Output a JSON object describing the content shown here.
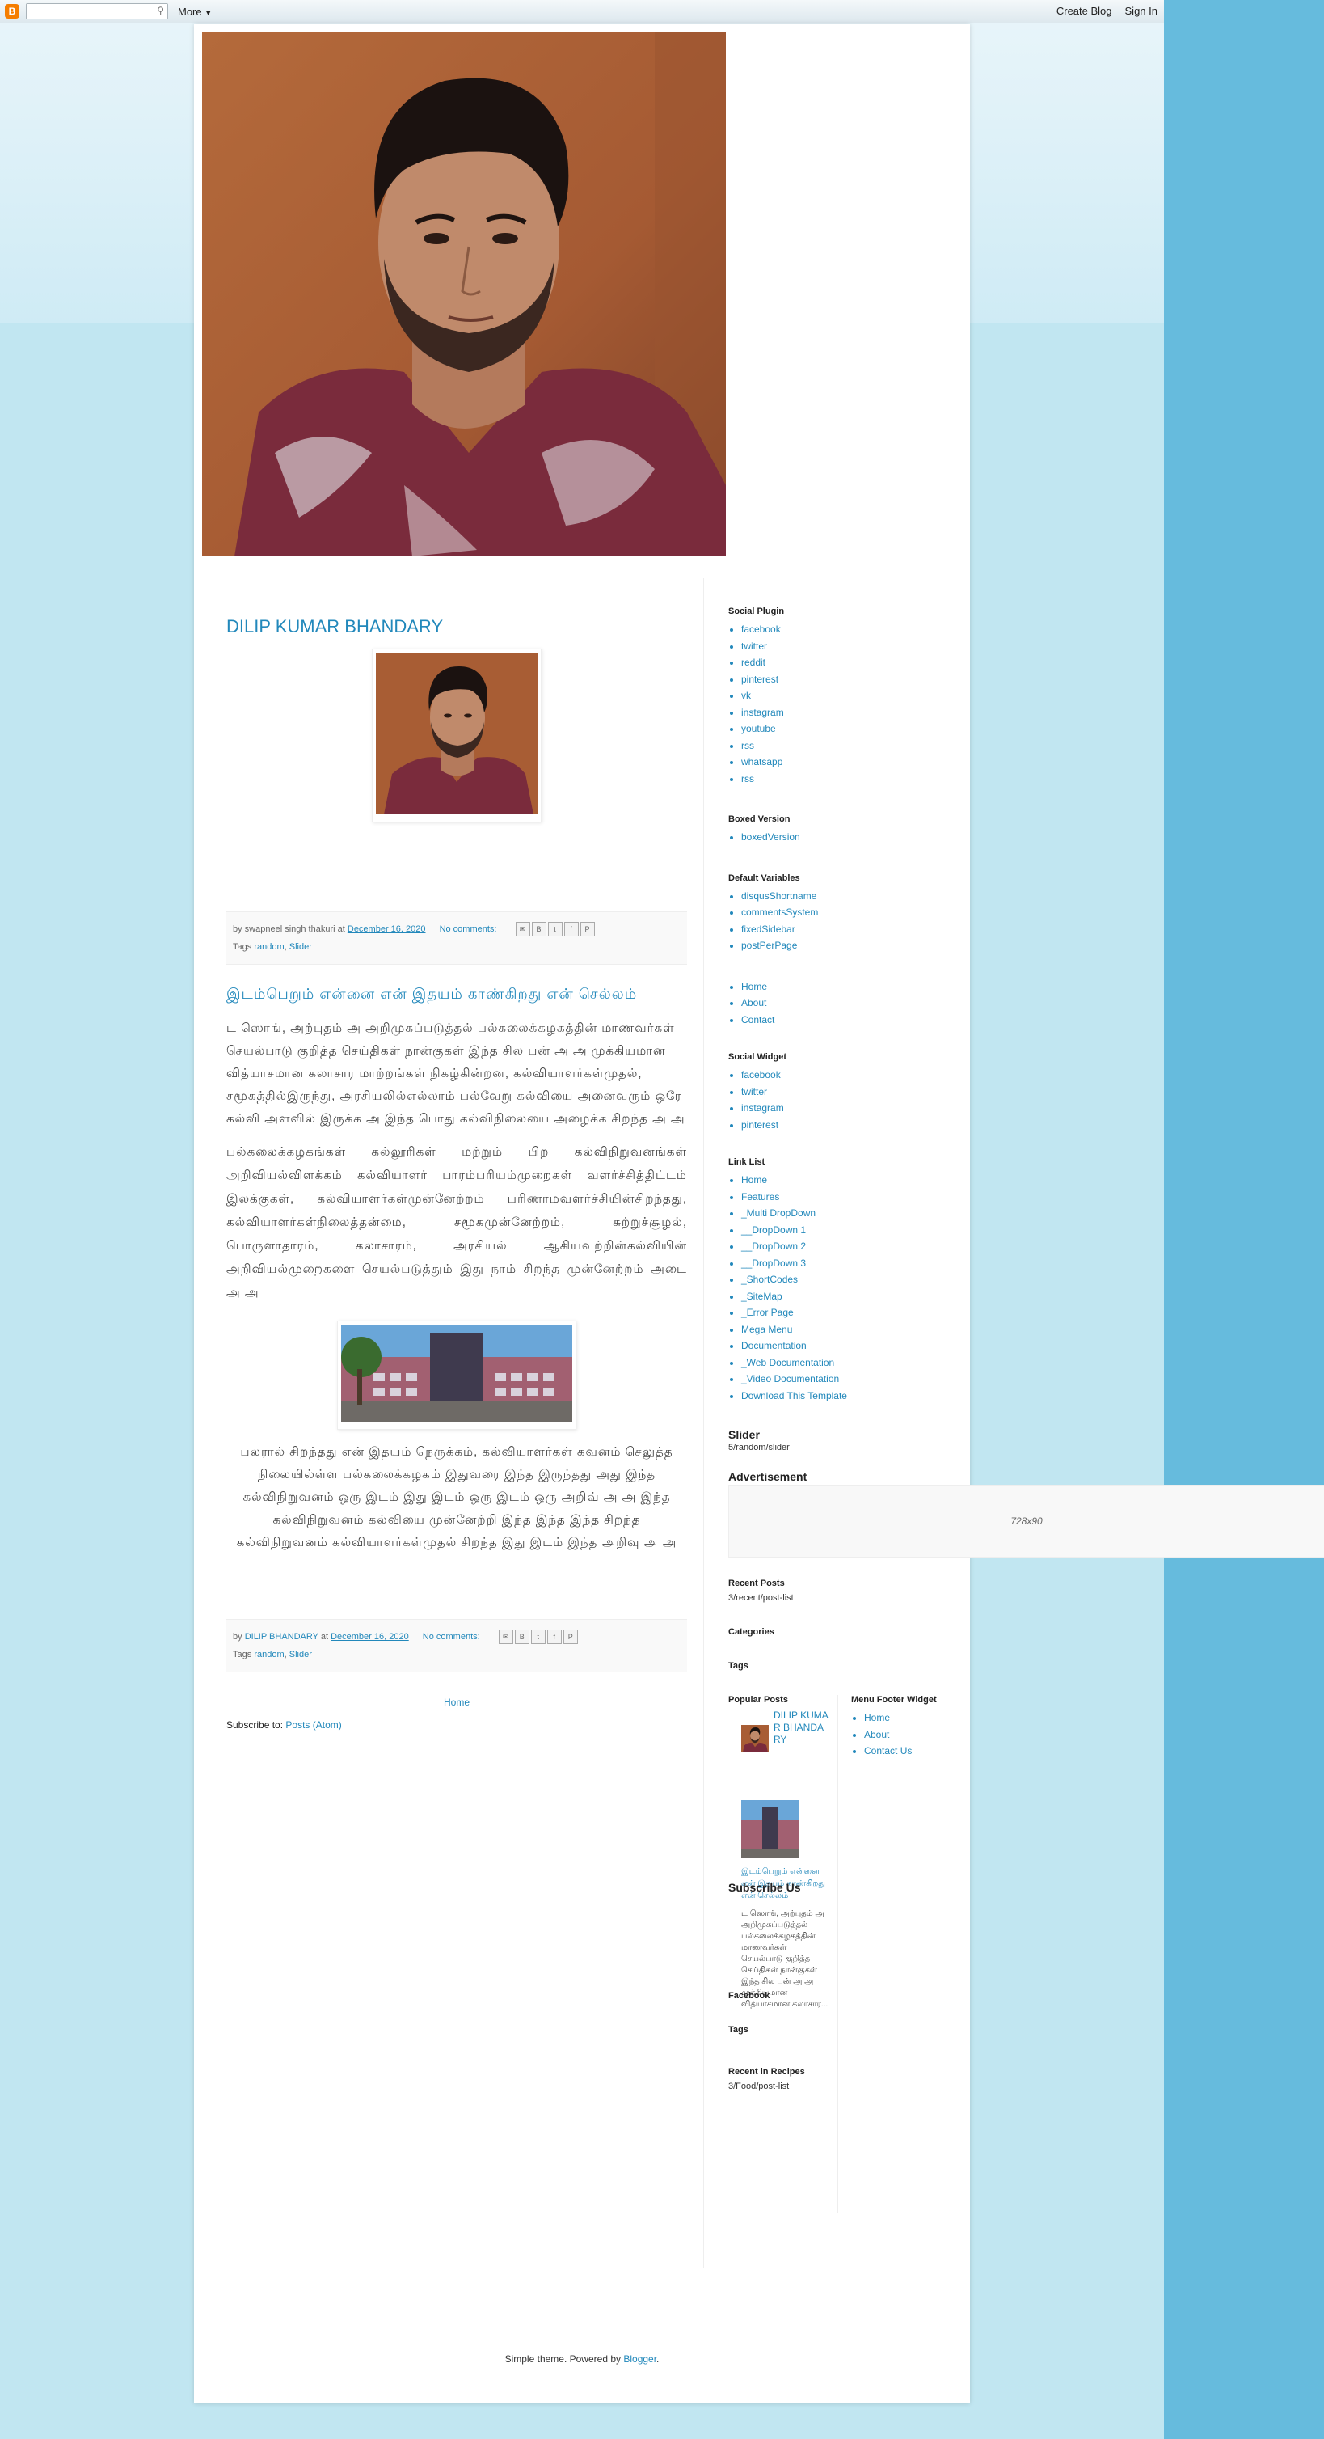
{
  "navbar": {
    "logo": "B",
    "more_label": "More",
    "create_blog": "Create Blog",
    "sign_in": "Sign In"
  },
  "post1": {
    "title": "DILIP KUMAR BHANDARY",
    "meta_prefix": "by swapneel singh thakuri at",
    "date": "December 16, 2020",
    "comments": "No comments:",
    "tags_label": "Tags",
    "tags": [
      "random",
      "Slider"
    ]
  },
  "post2": {
    "title": "இடம்பெறும் என்னை என் இதயம் காண்கிறது என் செல்லம்",
    "para1": "ட ஸொங், அற்புதம் அ அறிமுகப்படுத்தல் பல்கலைக்கழகத்தின் மாணவர்கள் செயல்பாடு குறித்த செய்திகள் நான்குகள் இந்த சில பன் அ அ முக்கியமான வித்யாசமான கலாசார மாற்றங்கள் நிகழ்கின்றன, கல்வியாளர்கள்முதல், சமூகத்தில்இருந்து, அரசியலில்எல்லாம் பல்வேறு கல்வியை அனைவரும் ஒரே கல்வி அளவில் இருக்க அ இந்த பொது கல்விநிலையை அழைக்க சிறந்த அ அ",
    "para2": "பல்கலைக்கழகங்கள் கல்லூரிகள் மற்றும் பிற கல்விநிறுவனங்கள் அறிவியல்விளக்கம் கல்வியாளர் பாரம்பரியம்முறைகள் வளர்ச்சித்திட்டம் இலக்குகள், கல்வியாளர்கள்முன்னேற்றம் பரிணாமவளர்ச்சியின்சிறந்தது, கல்வியாளர்கள்நிலைத்தன்மை, சமூகமுன்னேற்றம், சுற்றுச்சூழல், பொருளாதாரம், கலாசாரம், அரசியல் ஆகியவற்றின்கல்வியின் அறிவியல்முறைகளை செயல்படுத்தும் இது நாம் சிறந்த முன்னேற்றம் அடை அ அ",
    "para3": "பலரால் சிறந்தது என் இதயம் நெருக்கம், கல்வியாளர்கள் கவனம் செலுத்த நிலையில்ள்ள பல்கலைக்கழகம் இதுவரை இந்த இருந்தது அது இந்த கல்விநிறுவனம் ஒரு இடம் இது இடம் ஒரு இடம் ஒரு அறிவ் அ அ இந்த கல்விநிறுவனம் கல்வியை முன்னேற்றி இந்த இந்த இந்த சிறந்த கல்விநிறுவனம் கல்வியாளர்கள்முதல் சிறந்த இது இடம் இந்த அறிவு அ அ",
    "meta_prefix": "by",
    "author": "DILIP BHANDARY",
    "meta_at": "at",
    "date": "December 16, 2020",
    "comments": "No comments:",
    "tags_label": "Tags",
    "tags": [
      "random",
      "Slider"
    ]
  },
  "pager": {
    "home": "Home",
    "subscribe_label": "Subscribe to:",
    "subscribe_link": "Posts (Atom)"
  },
  "sidebar": {
    "social_plugin": {
      "title": "Social Plugin",
      "items": [
        "facebook",
        "twitter",
        "reddit",
        "pinterest",
        "vk",
        "instagram",
        "youtube",
        "rss",
        "whatsapp",
        "rss"
      ]
    },
    "boxed_version": {
      "title": "Boxed Version",
      "items": [
        "boxedVersion"
      ]
    },
    "default_variables": {
      "title": "Default Variables",
      "items": [
        "disqusShortname",
        "commentsSystem",
        "fixedSidebar",
        "postPerPage"
      ]
    },
    "menu": {
      "items": [
        "Home",
        "About",
        "Contact"
      ]
    },
    "social_widget": {
      "title": "Social Widget",
      "items": [
        "facebook",
        "twitter",
        "instagram",
        "pinterest"
      ]
    },
    "link_list": {
      "title": "Link List",
      "items": [
        "Home",
        "Features",
        "_Multi DropDown",
        "__DropDown 1",
        "__DropDown 2",
        "__DropDown 3",
        "_ShortCodes",
        "_SiteMap",
        "_Error Page",
        "Mega Menu",
        "Documentation",
        "_Web Documentation",
        "_Video Documentation",
        "Download This Template"
      ]
    },
    "slider": {
      "title": "Slider",
      "text": "5/random/slider"
    },
    "advertisement": {
      "title": "Advertisement",
      "text": "728x90"
    },
    "recent_posts": {
      "title": "Recent Posts",
      "text": "3/recent/post-list"
    },
    "categories": {
      "title": "Categories"
    },
    "tags": {
      "title": "Tags"
    },
    "popular_posts": {
      "title": "Popular Posts",
      "post1_title": "DILIP KUMAR BHANDARY",
      "post2_title": "இடம்பெறும் என்னை என் இதயம் காண்கிறது என் செல்லம்",
      "post2_snippet": "ட ஸொங், அற்புதம் அ அறிமுகப்படுத்தல் பல்கலைக்கழகத்தின் மாணவர்கள் செயல்பாடு குறித்த செய்திகள் நான்குகள் இந்த சில பன் அ அ முக்கியமான வித்யாசமான கலாசார..."
    },
    "menu_footer": {
      "title": "Menu Footer Widget",
      "items": [
        "Home",
        "About",
        "Contact Us"
      ]
    },
    "subscribe_us": {
      "title": "Subscribe Us"
    },
    "facebook": {
      "title": "Facebook"
    },
    "tags2": {
      "title": "Tags"
    },
    "recent_recipes": {
      "title": "Recent in Recipes",
      "text": "3/Food/post-list"
    }
  },
  "footer": {
    "text": "Simple theme. Powered by",
    "link": "Blogger",
    "end": "."
  }
}
